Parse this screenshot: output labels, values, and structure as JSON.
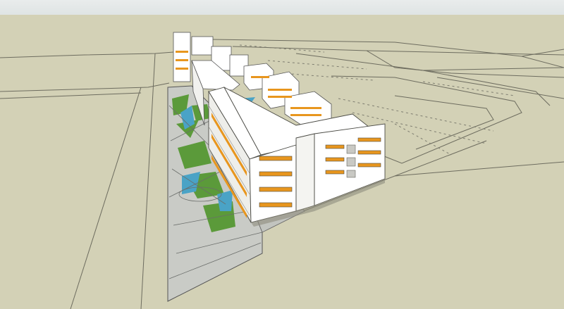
{
  "viewport": {
    "name": "3d-model-viewport",
    "sky_color": "#e4e9e9",
    "ground_color": "#d3d1b6",
    "plaza_color": "#c7c9c4",
    "facade_color": "#ffffff",
    "accent_color": "#e8961e",
    "green_color": "#5b9a3a",
    "water_color": "#4aa3c6",
    "line_color": "#4a4a44"
  },
  "caption": ""
}
